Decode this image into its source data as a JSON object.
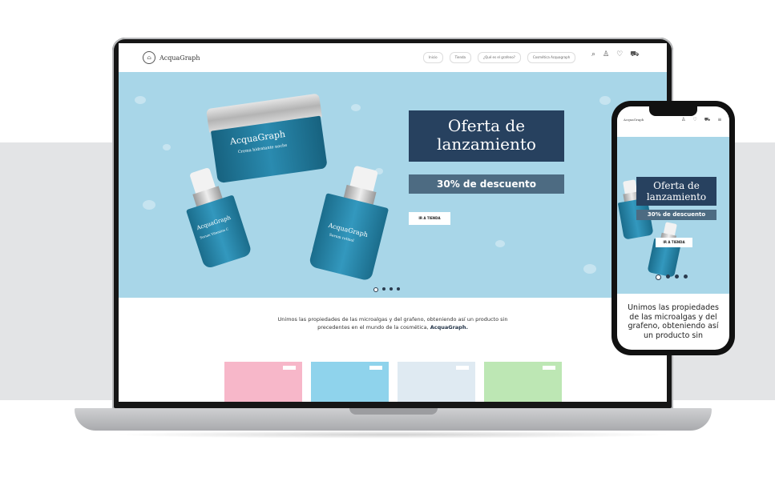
{
  "brand": {
    "name": "AcquaGraph",
    "logo_text": "AcquaGraph"
  },
  "nav": {
    "links": [
      "Inicio",
      "Tienda",
      "¿Qué es el grafeno?",
      "Cosmética Acquagraph"
    ]
  },
  "hero": {
    "offer_title": "Oferta de lanzamiento",
    "discount": "30% de descuento",
    "cta": "IR A TIENDA",
    "slides_total": 4,
    "active_slide": 1,
    "products": {
      "jar_brand": "AcquaGraph",
      "jar_label": "Crema hidratante noche",
      "left_bottle_brand": "AcquaGraph",
      "left_bottle_label": "Serum Vitamina C",
      "right_bottle_brand": "AcquaGraph",
      "right_bottle_label": "Serum retinol"
    }
  },
  "intro": {
    "text": "Unimos las propiedades de las microalgas y del grafeno, obteniendo así un producto sin precedentes en el mundo de la cosmética,",
    "brand_bold": "AcquaGraph."
  },
  "product_cards": [
    {
      "color": "#f7b7c9"
    },
    {
      "color": "#8fd3ec"
    },
    {
      "color": "#dfeaf2"
    },
    {
      "color": "#bde7b4"
    }
  ],
  "mobile": {
    "logo_text": "AcquaGraph",
    "offer_title": "Oferta de lanzamiento",
    "discount": "30% de descuento",
    "cta": "IR A TIENDA",
    "intro_text": "Unimos las propiedades de las microalgas y del grafeno, obteniendo así un producto sin"
  },
  "colors": {
    "hero_bg": "#a8d6e8",
    "offer_bg": "#27415f",
    "discount_bg": "#4d6b82",
    "bottle_blue": "#1b6d8c"
  }
}
